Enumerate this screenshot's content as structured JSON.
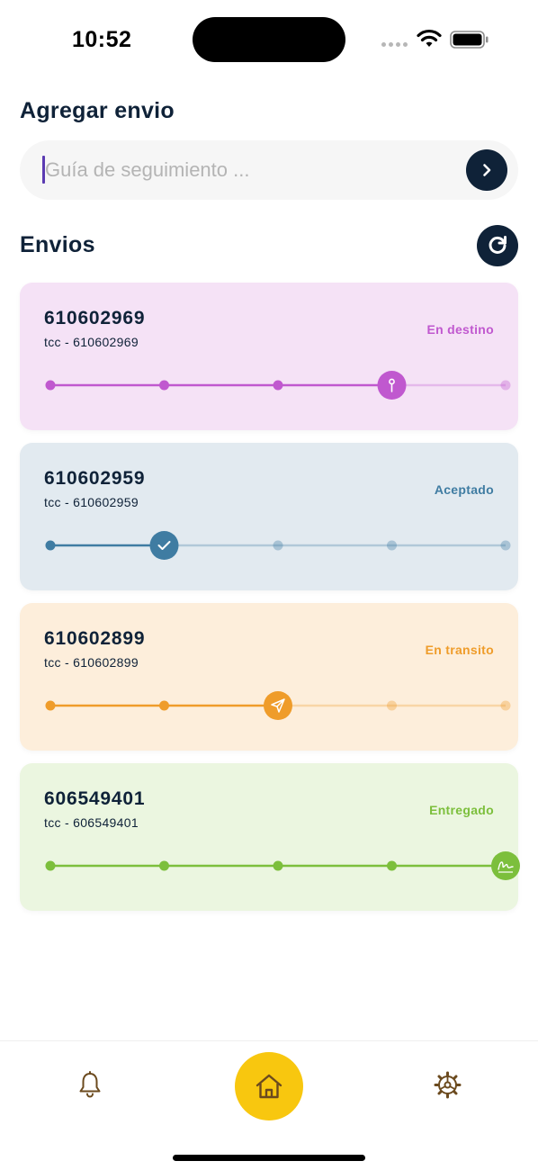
{
  "status_bar": {
    "time": "10:52"
  },
  "add_section": {
    "title": "Agregar envio",
    "search": {
      "placeholder": "Guía de seguimiento ...",
      "value": ""
    }
  },
  "shipments_section": {
    "title": "Envios"
  },
  "shipments": [
    {
      "number": "610602969",
      "subtitle": "tcc - 610602969",
      "status": "En destino",
      "color": "#c058cf",
      "background": "#f5e2f6",
      "step_reached": 4,
      "total_steps": 5,
      "current_icon": "pin-icon"
    },
    {
      "number": "610602959",
      "subtitle": "tcc - 610602959",
      "status": "Aceptado",
      "color": "#3f7ca2",
      "background": "#e2eaf0",
      "step_reached": 2,
      "total_steps": 5,
      "current_icon": "check-icon"
    },
    {
      "number": "610602899",
      "subtitle": "tcc - 610602899",
      "status": "En transito",
      "color": "#ef9c2a",
      "background": "#fdeedb",
      "step_reached": 3,
      "total_steps": 5,
      "current_icon": "send-icon"
    },
    {
      "number": "606549401",
      "subtitle": "tcc - 606549401",
      "status": "Entregado",
      "color": "#7cbf3c",
      "background": "#ebf6e0",
      "step_reached": 5,
      "total_steps": 5,
      "current_icon": "signature-icon"
    }
  ],
  "tabbar": {
    "items": [
      "bell-icon",
      "home-icon",
      "gear-icon"
    ],
    "active": "home-icon",
    "accent": "#f8c70f",
    "icon_color": "#6b4a1e"
  },
  "colors": {
    "primary_dark": "#0f2238",
    "cursor": "#5b3bb2"
  }
}
